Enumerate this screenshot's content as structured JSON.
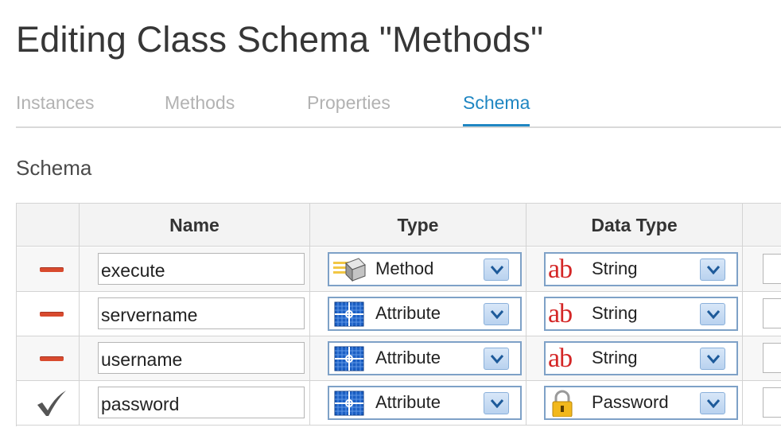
{
  "page_title": "Editing Class Schema \"Methods\"",
  "tabs": [
    {
      "label": "Instances"
    },
    {
      "label": "Methods"
    },
    {
      "label": "Properties"
    },
    {
      "label": "Schema"
    }
  ],
  "active_tab": "Schema",
  "section_title": "Schema",
  "table": {
    "headers": [
      "",
      "Name",
      "Type",
      "Data Type",
      ""
    ],
    "rows": [
      {
        "action_icon": "remove-icon",
        "name": "execute",
        "type": "Method",
        "type_icon": "method-icon",
        "data_type": "String",
        "data_type_icon": "string-ab-icon"
      },
      {
        "action_icon": "remove-icon",
        "name": "servername",
        "type": "Attribute",
        "type_icon": "attribute-icon",
        "data_type": "String",
        "data_type_icon": "string-ab-icon"
      },
      {
        "action_icon": "remove-icon",
        "name": "username",
        "type": "Attribute",
        "type_icon": "attribute-icon",
        "data_type": "String",
        "data_type_icon": "string-ab-icon"
      },
      {
        "action_icon": "checkmark-icon",
        "name": "password",
        "type": "Attribute",
        "type_icon": "attribute-icon",
        "data_type": "Password",
        "data_type_icon": "padlock-icon"
      }
    ]
  },
  "colors": {
    "accent": "#1f86c2",
    "tab_inactive": "#b2b2b2",
    "remove": "#d84a2e",
    "string_icon": "#d42626",
    "select_border": "#7ea1c7"
  },
  "ab_text": "ab"
}
